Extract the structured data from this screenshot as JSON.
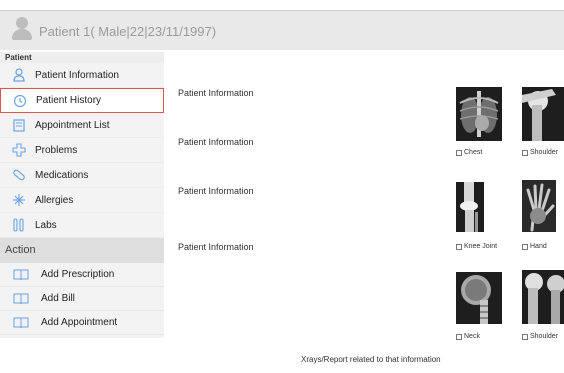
{
  "header": {
    "patient_title": "Patient 1( Male|22|23/11/1997)"
  },
  "sidebar": {
    "section_label": "Patient",
    "items": [
      {
        "label": "Patient Information",
        "icon": "person-icon"
      },
      {
        "label": "Patient History",
        "icon": "history-icon"
      },
      {
        "label": "Appointment List",
        "icon": "calendar-list-icon"
      },
      {
        "label": "Problems",
        "icon": "medical-cross-icon"
      },
      {
        "label": "Medications",
        "icon": "pill-icon"
      },
      {
        "label": "Allergies",
        "icon": "allergy-icon"
      },
      {
        "label": "Labs",
        "icon": "lab-flask-icon"
      }
    ],
    "selected_index": 1,
    "action_header": "Action",
    "actions": [
      {
        "label": "Add Prescription",
        "icon": "book-icon"
      },
      {
        "label": "Add Bill",
        "icon": "book-icon"
      },
      {
        "label": "Add Appointment",
        "icon": "book-icon"
      }
    ]
  },
  "main": {
    "info_labels": [
      "Patient Information",
      "Patient Information",
      "Patient Information",
      "Patient Information"
    ],
    "xrays": [
      {
        "caption": "Chest"
      },
      {
        "caption": "Shoulder"
      },
      {
        "caption": "Knee Joint"
      },
      {
        "caption": "Hand"
      },
      {
        "caption": "Neck"
      },
      {
        "caption": "Shoulder"
      }
    ],
    "footer_note": "Xrays/Report related to that information"
  },
  "colors": {
    "accent": "#6aa3e6",
    "selected_border": "#e05353",
    "header_bg": "#e9e9e9"
  }
}
